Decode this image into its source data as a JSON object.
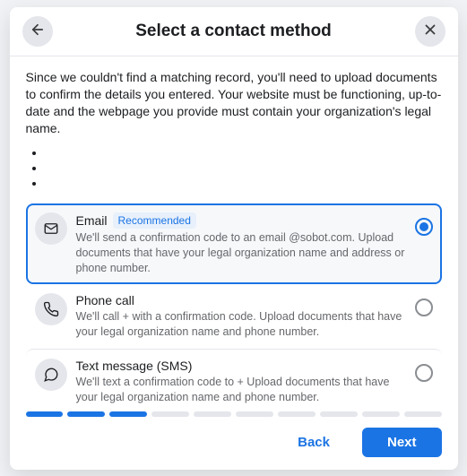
{
  "header": {
    "title": "Select a contact method"
  },
  "description": "Since we couldn't find a matching record, you'll need to upload documents to confirm the details you entered. Your website must be functioning, up-to-date and the webpage you provide must contain your organization's legal name.",
  "options": {
    "email": {
      "title": "Email",
      "badge": "Recommended",
      "sub": "We'll send a confirmation code to an email @sobot.com. Upload documents that have your legal organization name and address or phone number."
    },
    "phone": {
      "title": "Phone call",
      "sub": "We'll call +                           with a confirmation code. Upload documents that have your legal organization name and phone number."
    },
    "sms": {
      "title": "Text message (SMS)",
      "sub": "We'll text a confirmation code to +                        Upload documents that have your legal organization name and phone number."
    }
  },
  "progress": {
    "filled": 3,
    "total": 10
  },
  "footer": {
    "back": "Back",
    "next": "Next"
  }
}
